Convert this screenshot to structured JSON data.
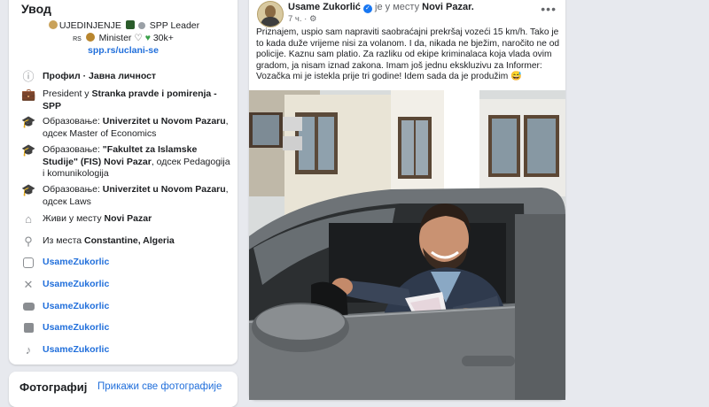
{
  "intro": {
    "title": "Увод",
    "bio_line1": "UJEDINJENJE",
    "bio_line1b": "SPP Leader",
    "bio_line2a": "RS",
    "bio_line2b": "Minister",
    "bio_line2c": "30k+",
    "bio_link": "spp.rs/uclani-se",
    "rows": [
      {
        "icon": "info-icon",
        "pre": "Профил · Јавна личност",
        "bold": "",
        "post": ""
      },
      {
        "icon": "briefcase-icon",
        "pre": "President у ",
        "bold": "Stranka pravde i pomirenja - SPP",
        "post": ""
      },
      {
        "icon": "graduation-cap-icon",
        "pre": "Образовање: ",
        "bold": "Univerzitet u Novom Pazaru",
        "post": ", одсек Master of Economics"
      },
      {
        "icon": "graduation-cap-icon",
        "pre": "Образовање: ",
        "bold": "\"Fakultet za Islamske Studije\" (FIS) Novi Pazar",
        "post": ", одсек Pedagogija i komunikologija"
      },
      {
        "icon": "graduation-cap-icon",
        "pre": "Образовање: ",
        "bold": "Univerzitet u Novom Pazaru",
        "post": ", одсек Laws"
      },
      {
        "icon": "home-icon",
        "pre": "Живи у месту ",
        "bold": "Novi Pazar",
        "post": ""
      },
      {
        "icon": "location-pin-icon",
        "pre": "Из места ",
        "bold": "Constantine, Algeria",
        "post": ""
      }
    ],
    "social": [
      {
        "icon": "instagram-icon",
        "label": "UsameZukorlic"
      },
      {
        "icon": "x-icon",
        "label": "UsameZukorlic"
      },
      {
        "icon": "youtube-icon",
        "label": "UsameZukorlic"
      },
      {
        "icon": "linkedin-icon",
        "label": "UsameZukorlic"
      },
      {
        "icon": "tiktok-icon",
        "label": "UsameZukorlic"
      }
    ]
  },
  "photos": {
    "title": "Фотографиј",
    "show_all": "Прикажи све фотографије"
  },
  "post": {
    "author": "Usame Zukorlić",
    "location_pre": "је у месту",
    "location": "Novi Pazar.",
    "time": "7 ч.",
    "text": "Priznajem, uspio sam napraviti saobraćajni prekršaj vozeći 15 km/h. Tako je to kada duže vrijeme nisi za volanom. I da, nikada ne bježim, naročito ne od policije. Kaznu sam platio. Za razliku od ekipe kriminalaca koja vlada ovim gradom, ja nisam iznad zakona. Imam još jednu ekskluzivu za Informer: Vozačka mi je istekla prije tri godine! Idem sada da je produžim 😅"
  },
  "colors": {
    "link": "#216fdb",
    "background": "#e7e9ee",
    "icon_gray": "#8a8d91"
  }
}
